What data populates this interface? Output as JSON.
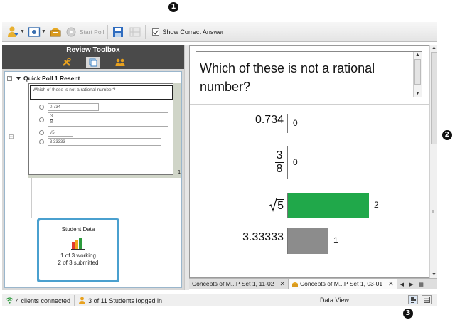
{
  "callouts": {
    "one": "1",
    "two": "2",
    "three": "3"
  },
  "toolbar": {
    "start_poll_label": "Start Poll",
    "show_correct_answer_label": "Show Correct Answer",
    "show_correct_answer_checked": true
  },
  "review_toolbox": {
    "title": "Review Toolbox",
    "tabs": [
      "tools-icon",
      "document-icon",
      "students-icon"
    ],
    "active_tab": 1
  },
  "tree": {
    "expand_symbol": "⊟",
    "poll_title": "Quick Poll 1 Resent",
    "thumbnail": {
      "question": "Which of these is not a rational number?",
      "options": [
        "0.734",
        "3/8",
        "√5",
        "3.33333"
      ],
      "page_number": "1"
    },
    "student_data": {
      "title": "Student Data",
      "line1": "1 of 3 working",
      "line2": "2 of 3 submitted"
    }
  },
  "question": {
    "text": "Which of these is not a rational number?"
  },
  "results": {
    "rows": [
      {
        "label": "0.734",
        "count": "0",
        "value": 0,
        "color": ""
      },
      {
        "label": "3/8",
        "numerator": "3",
        "denominator": "8",
        "count": "0",
        "value": 0,
        "color": ""
      },
      {
        "label": "√5",
        "radicand": "5",
        "count": "2",
        "value": 2,
        "color": "#20a84a"
      },
      {
        "label": "3.33333",
        "count": "1",
        "value": 1,
        "color": "#8c8c8c"
      }
    ]
  },
  "doc_tabs": [
    {
      "label": "Concepts of M...P Set 1, 11-02",
      "active": false
    },
    {
      "label": "Concepts of M...P Set 1, 03-01",
      "active": true
    }
  ],
  "status": {
    "clients": "4 clients connected",
    "students": "3 of 11 Students logged in",
    "data_view_label": "Data View:"
  },
  "colors": {
    "toolbox_header": "#4a4a4a",
    "student_card_border": "#4aa0cf",
    "correct_bar": "#20a84a",
    "other_bar": "#8c8c8c"
  }
}
